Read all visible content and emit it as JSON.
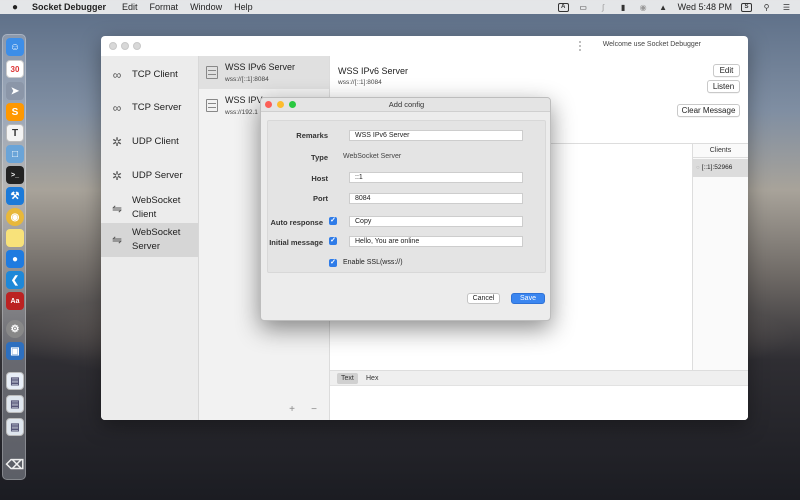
{
  "menubar": {
    "app_name": "Socket Debugger",
    "items": [
      "Edit",
      "Format",
      "Window",
      "Help"
    ],
    "clock": "Wed 5:48 PM"
  },
  "window": {
    "title": "Welcome use Socket Debugger"
  },
  "sidebar": {
    "items": [
      {
        "label": "TCP Client",
        "icon": "link-icon"
      },
      {
        "label": "TCP Server",
        "icon": "link-icon"
      },
      {
        "label": "UDP Client",
        "icon": "broadcast-icon"
      },
      {
        "label": "UDP Server",
        "icon": "broadcast-icon"
      },
      {
        "label": "WebSocket Client",
        "icon": "websocket-icon"
      },
      {
        "label": "WebSocket Server",
        "icon": "websocket-icon"
      }
    ],
    "active_index": 5
  },
  "server_list": {
    "items": [
      {
        "title": "WSS IPv6 Server",
        "subtitle": "wss://[::1]:8084"
      },
      {
        "title": "WSS IPV",
        "subtitle": "wss://192.1"
      }
    ],
    "add_label": "+",
    "remove_label": "−"
  },
  "detail": {
    "title": "WSS IPv6 Server",
    "subtitle": "wss://[::1]:8084",
    "edit_label": "Edit",
    "listen_label": "Listen",
    "clear_label": "Clear Message",
    "clients_header": "Clients",
    "clients": [
      "[::1]:52966"
    ],
    "modes": [
      "Text",
      "Hex"
    ]
  },
  "dialog": {
    "title": "Add config",
    "fields": {
      "remarks_label": "Remarks",
      "remarks_value": "WSS IPv6 Server",
      "type_label": "Type",
      "type_value": "WebSocket Server",
      "host_label": "Host",
      "host_value": "::1",
      "port_label": "Port",
      "port_value": "8084",
      "auto_response_label": "Auto response",
      "auto_response_value": "Copy",
      "initial_message_label": "Initial message",
      "initial_message_value": "Hello, You are online",
      "ssl_label": "Enable SSL(wss://)"
    },
    "cancel_label": "Cancel",
    "save_label": "Save"
  },
  "colors": {
    "accent": "#3b86f0",
    "traffic_red": "#fc5f57",
    "traffic_yellow": "#fdbc2e",
    "traffic_green": "#29c840"
  }
}
